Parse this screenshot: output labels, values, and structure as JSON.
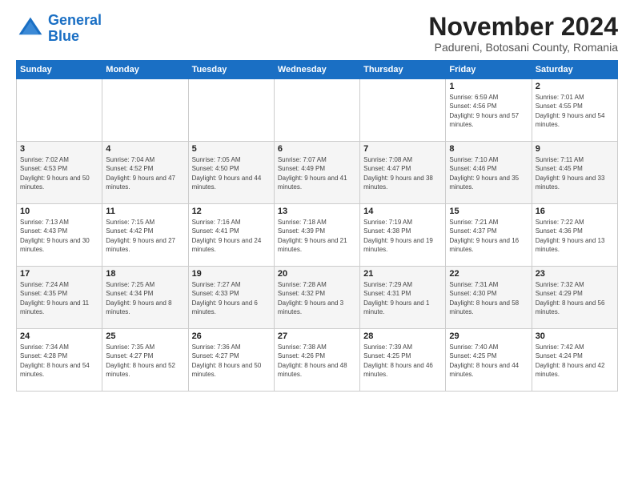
{
  "logo": {
    "line1": "General",
    "line2": "Blue"
  },
  "title": "November 2024",
  "location": "Padureni, Botosani County, Romania",
  "days_of_week": [
    "Sunday",
    "Monday",
    "Tuesday",
    "Wednesday",
    "Thursday",
    "Friday",
    "Saturday"
  ],
  "weeks": [
    [
      {
        "day": "",
        "info": ""
      },
      {
        "day": "",
        "info": ""
      },
      {
        "day": "",
        "info": ""
      },
      {
        "day": "",
        "info": ""
      },
      {
        "day": "",
        "info": ""
      },
      {
        "day": "1",
        "info": "Sunrise: 6:59 AM\nSunset: 4:56 PM\nDaylight: 9 hours and 57 minutes."
      },
      {
        "day": "2",
        "info": "Sunrise: 7:01 AM\nSunset: 4:55 PM\nDaylight: 9 hours and 54 minutes."
      }
    ],
    [
      {
        "day": "3",
        "info": "Sunrise: 7:02 AM\nSunset: 4:53 PM\nDaylight: 9 hours and 50 minutes."
      },
      {
        "day": "4",
        "info": "Sunrise: 7:04 AM\nSunset: 4:52 PM\nDaylight: 9 hours and 47 minutes."
      },
      {
        "day": "5",
        "info": "Sunrise: 7:05 AM\nSunset: 4:50 PM\nDaylight: 9 hours and 44 minutes."
      },
      {
        "day": "6",
        "info": "Sunrise: 7:07 AM\nSunset: 4:49 PM\nDaylight: 9 hours and 41 minutes."
      },
      {
        "day": "7",
        "info": "Sunrise: 7:08 AM\nSunset: 4:47 PM\nDaylight: 9 hours and 38 minutes."
      },
      {
        "day": "8",
        "info": "Sunrise: 7:10 AM\nSunset: 4:46 PM\nDaylight: 9 hours and 35 minutes."
      },
      {
        "day": "9",
        "info": "Sunrise: 7:11 AM\nSunset: 4:45 PM\nDaylight: 9 hours and 33 minutes."
      }
    ],
    [
      {
        "day": "10",
        "info": "Sunrise: 7:13 AM\nSunset: 4:43 PM\nDaylight: 9 hours and 30 minutes."
      },
      {
        "day": "11",
        "info": "Sunrise: 7:15 AM\nSunset: 4:42 PM\nDaylight: 9 hours and 27 minutes."
      },
      {
        "day": "12",
        "info": "Sunrise: 7:16 AM\nSunset: 4:41 PM\nDaylight: 9 hours and 24 minutes."
      },
      {
        "day": "13",
        "info": "Sunrise: 7:18 AM\nSunset: 4:39 PM\nDaylight: 9 hours and 21 minutes."
      },
      {
        "day": "14",
        "info": "Sunrise: 7:19 AM\nSunset: 4:38 PM\nDaylight: 9 hours and 19 minutes."
      },
      {
        "day": "15",
        "info": "Sunrise: 7:21 AM\nSunset: 4:37 PM\nDaylight: 9 hours and 16 minutes."
      },
      {
        "day": "16",
        "info": "Sunrise: 7:22 AM\nSunset: 4:36 PM\nDaylight: 9 hours and 13 minutes."
      }
    ],
    [
      {
        "day": "17",
        "info": "Sunrise: 7:24 AM\nSunset: 4:35 PM\nDaylight: 9 hours and 11 minutes."
      },
      {
        "day": "18",
        "info": "Sunrise: 7:25 AM\nSunset: 4:34 PM\nDaylight: 9 hours and 8 minutes."
      },
      {
        "day": "19",
        "info": "Sunrise: 7:27 AM\nSunset: 4:33 PM\nDaylight: 9 hours and 6 minutes."
      },
      {
        "day": "20",
        "info": "Sunrise: 7:28 AM\nSunset: 4:32 PM\nDaylight: 9 hours and 3 minutes."
      },
      {
        "day": "21",
        "info": "Sunrise: 7:29 AM\nSunset: 4:31 PM\nDaylight: 9 hours and 1 minute."
      },
      {
        "day": "22",
        "info": "Sunrise: 7:31 AM\nSunset: 4:30 PM\nDaylight: 8 hours and 58 minutes."
      },
      {
        "day": "23",
        "info": "Sunrise: 7:32 AM\nSunset: 4:29 PM\nDaylight: 8 hours and 56 minutes."
      }
    ],
    [
      {
        "day": "24",
        "info": "Sunrise: 7:34 AM\nSunset: 4:28 PM\nDaylight: 8 hours and 54 minutes."
      },
      {
        "day": "25",
        "info": "Sunrise: 7:35 AM\nSunset: 4:27 PM\nDaylight: 8 hours and 52 minutes."
      },
      {
        "day": "26",
        "info": "Sunrise: 7:36 AM\nSunset: 4:27 PM\nDaylight: 8 hours and 50 minutes."
      },
      {
        "day": "27",
        "info": "Sunrise: 7:38 AM\nSunset: 4:26 PM\nDaylight: 8 hours and 48 minutes."
      },
      {
        "day": "28",
        "info": "Sunrise: 7:39 AM\nSunset: 4:25 PM\nDaylight: 8 hours and 46 minutes."
      },
      {
        "day": "29",
        "info": "Sunrise: 7:40 AM\nSunset: 4:25 PM\nDaylight: 8 hours and 44 minutes."
      },
      {
        "day": "30",
        "info": "Sunrise: 7:42 AM\nSunset: 4:24 PM\nDaylight: 8 hours and 42 minutes."
      }
    ]
  ]
}
